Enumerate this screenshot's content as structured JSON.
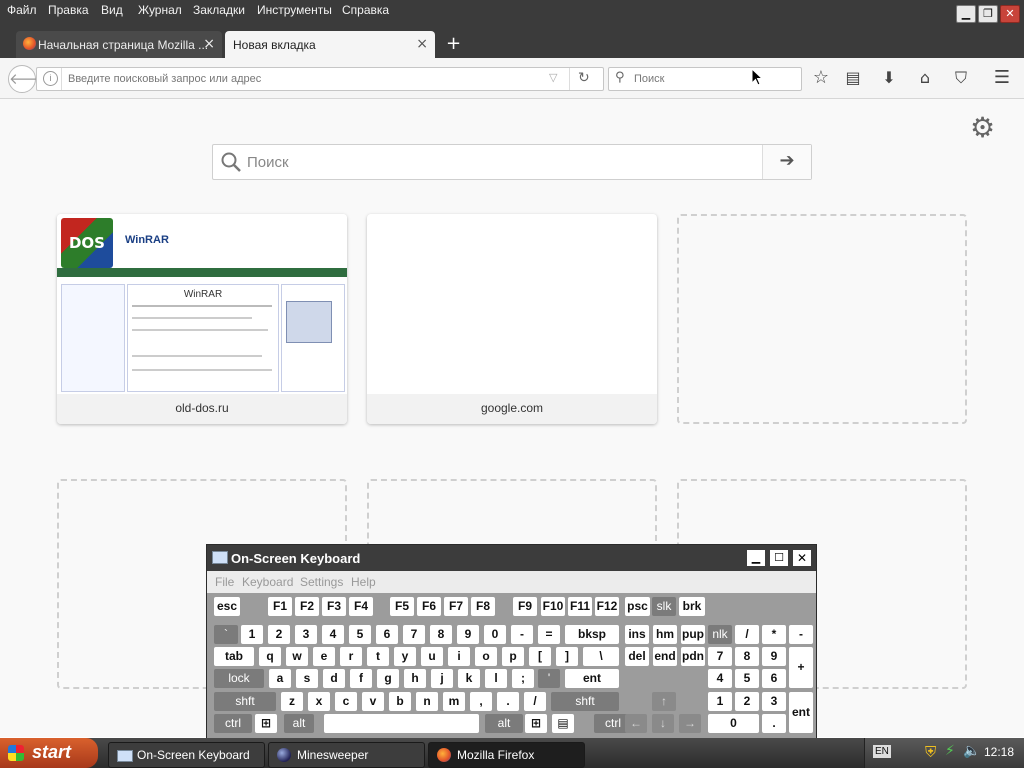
{
  "menu": [
    "Файл",
    "Правка",
    "Вид",
    "Журнал",
    "Закладки",
    "Инструменты",
    "Справка"
  ],
  "tabs": [
    {
      "title": "Начальная страница Mozilla ...",
      "close": "×",
      "active": false
    },
    {
      "title": "Новая вкладка",
      "close": "×",
      "active": true
    }
  ],
  "new_tab_symbol": "+",
  "url_placeholder": "Введите поисковый запрос или адрес",
  "search_placeholder": "Поиск",
  "page_search_placeholder": "Поиск",
  "tiles": [
    {
      "caption": "old-dos.ru",
      "preview_title": "WinRAR",
      "preview_heading": "WinRAR",
      "logo_text": "DOS"
    },
    {
      "caption": "google.com"
    }
  ],
  "osk": {
    "title": "On-Screen Keyboard",
    "menu": [
      "File",
      "Keyboard",
      "Settings",
      "Help"
    ],
    "rows": [
      [
        "esc",
        "F1",
        "F2",
        "F3",
        "F4",
        "F5",
        "F6",
        "F7",
        "F8",
        "F9",
        "F10",
        "F11",
        "F12",
        "psc",
        "slk",
        "brk"
      ],
      [
        "`",
        "1",
        "2",
        "3",
        "4",
        "5",
        "6",
        "7",
        "8",
        "9",
        "0",
        "-",
        "=",
        "bksp",
        "ins",
        "hm",
        "pup",
        "nlk",
        "/",
        "*",
        "-"
      ],
      [
        "tab",
        "q",
        "w",
        "e",
        "r",
        "t",
        "y",
        "u",
        "i",
        "o",
        "p",
        "[",
        "]",
        "\\",
        "del",
        "end",
        "pdn",
        "7",
        "8",
        "9",
        "+"
      ],
      [
        "lock",
        "a",
        "s",
        "d",
        "f",
        "g",
        "h",
        "j",
        "k",
        "l",
        ";",
        "'",
        "ent",
        "4",
        "5",
        "6"
      ],
      [
        "shft",
        "z",
        "x",
        "c",
        "v",
        "b",
        "n",
        "m",
        ",",
        ".",
        "/",
        "shft",
        "↑",
        "1",
        "2",
        "3",
        "ent"
      ],
      [
        "ctrl",
        "alt",
        "alt",
        "ctrl",
        "←",
        "↓",
        "→",
        "0",
        "."
      ]
    ]
  },
  "taskbar": {
    "start": "start",
    "tasks": [
      "On-Screen Keyboard",
      "Minesweeper",
      "Mozilla Firefox"
    ],
    "lang": "EN",
    "time": "12:18"
  },
  "colors": {
    "titlebar": "#3b3b3b",
    "start": "#c24a22",
    "tray": "#4a4a4a"
  }
}
